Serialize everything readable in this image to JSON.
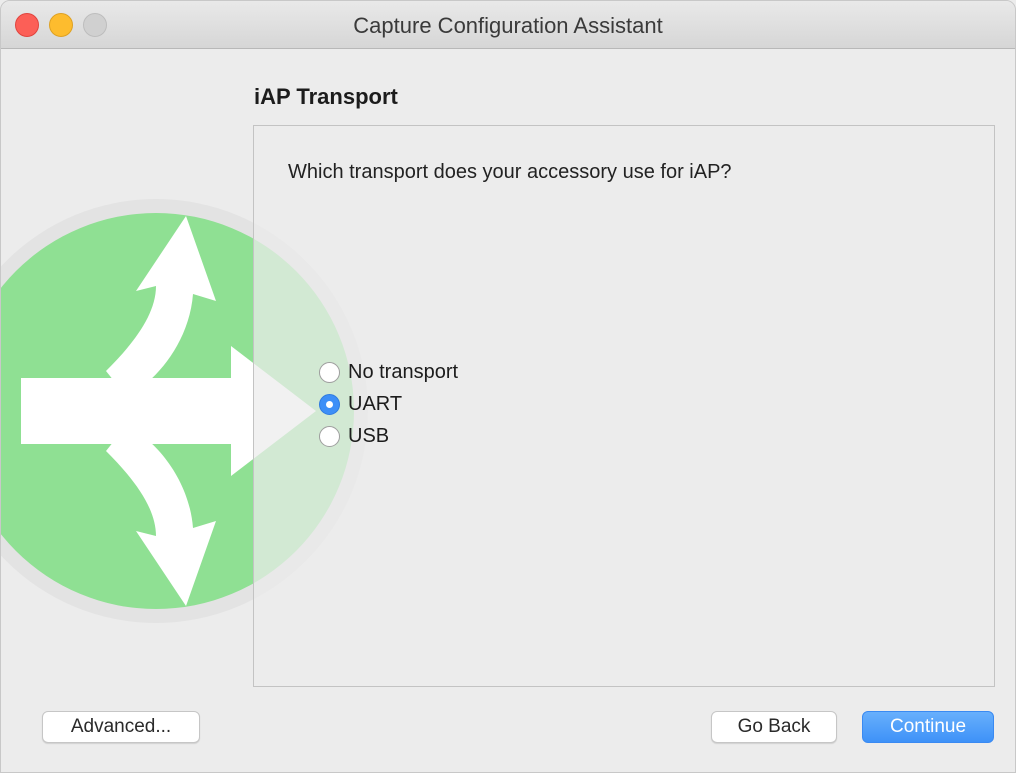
{
  "window": {
    "title": "Capture Configuration Assistant"
  },
  "page": {
    "heading": "iAP Transport",
    "question": "Which transport does your accessory use for iAP?"
  },
  "options": [
    {
      "label": "No transport",
      "selected": false
    },
    {
      "label": "UART",
      "selected": true
    },
    {
      "label": "USB",
      "selected": false
    }
  ],
  "buttons": {
    "advanced": "Advanced...",
    "back": "Go Back",
    "continue": "Continue"
  },
  "colors": {
    "accent": "#3d8ff7",
    "logo_green": "#8fe093",
    "close": "#fc5f57",
    "minimize": "#fdbc2e"
  },
  "icons": {
    "logo": "split-arrows-icon"
  }
}
